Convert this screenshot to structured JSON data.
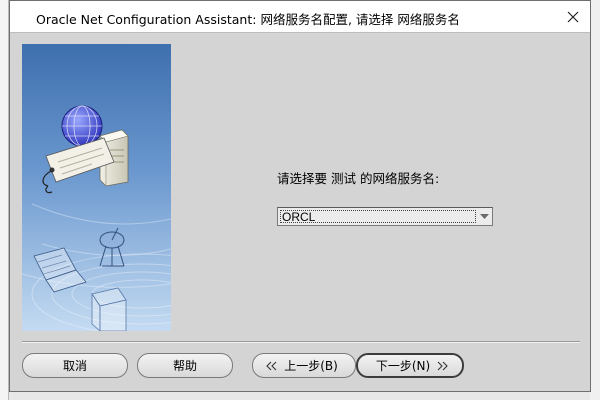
{
  "window": {
    "title": "Oracle Net Configuration Assistant: 网络服务名配置, 请选择 网络服务名",
    "close_icon": "close-icon"
  },
  "main": {
    "prompt": "请选择要 测试 的网络服务名:",
    "service_select": {
      "value": "ORCL",
      "options": [
        "ORCL"
      ]
    }
  },
  "buttons": {
    "cancel": "取消",
    "help": "帮助",
    "back": "上一步(B)",
    "next": "下一步(N)"
  },
  "icons": {
    "back": "chevron-double-left-icon",
    "next": "chevron-double-right-icon",
    "dropdown": "triangle-down-icon"
  },
  "colors": {
    "dialog_bg": "#d4d4d4",
    "art_top": "#4a7ab8",
    "art_bottom": "#b9d3ee"
  }
}
